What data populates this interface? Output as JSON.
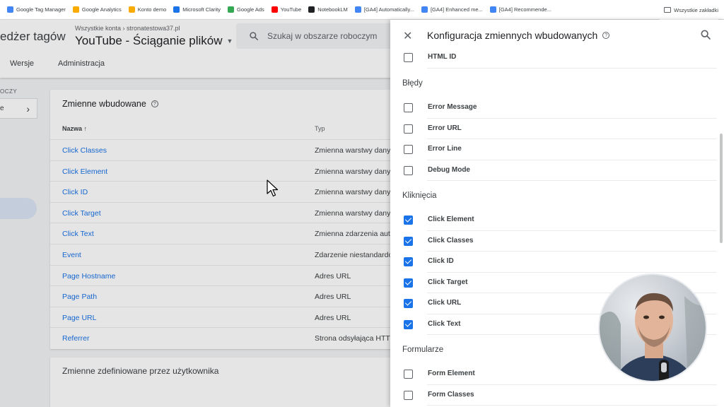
{
  "bookmarks": {
    "items": [
      {
        "label": "Google Tag Manager",
        "color": "#4285f4"
      },
      {
        "label": "Google Analytics",
        "color": "#f9ab00"
      },
      {
        "label": "Konto demo",
        "color": "#f9ab00"
      },
      {
        "label": "Microsoft Clarity",
        "color": "#1a73e8"
      },
      {
        "label": "Google Ads",
        "color": "#34a853"
      },
      {
        "label": "YouTube",
        "color": "#ff0000"
      },
      {
        "label": "NotebookLM",
        "color": "#202124"
      },
      {
        "label": "[GA4] Automatically...",
        "color": "#4285f4"
      },
      {
        "label": "[GA4] Enhanced me...",
        "color": "#4285f4"
      },
      {
        "label": "[GA4] Recommende...",
        "color": "#4285f4"
      }
    ],
    "all_bookmarks": "Wszystkie zakładki"
  },
  "header": {
    "product": "edżer tagów",
    "breadcrumb": "Wszystkie konta › stronatestowa37.pl",
    "container": "YouTube - Ściąganie plików",
    "search_placeholder": "Szukaj w obszarze roboczym",
    "tabs": [
      "Wersje",
      "Administracja"
    ]
  },
  "left": {
    "workspace_label": "OCZY",
    "workspace_value": "e"
  },
  "builtin": {
    "title": "Zmienne wbudowane",
    "col_name": "Nazwa ↑",
    "col_type": "Typ",
    "rows": [
      {
        "name": "Click Classes",
        "type": "Zmienna warstwy danych"
      },
      {
        "name": "Click Element",
        "type": "Zmienna warstwy danych"
      },
      {
        "name": "Click ID",
        "type": "Zmienna warstwy danych"
      },
      {
        "name": "Click Target",
        "type": "Zmienna warstwy danych"
      },
      {
        "name": "Click Text",
        "type": "Zmienna zdarzenia automatycznego"
      },
      {
        "name": "Event",
        "type": "Zdarzenie niestandardowe"
      },
      {
        "name": "Page Hostname",
        "type": "Adres URL"
      },
      {
        "name": "Page Path",
        "type": "Adres URL"
      },
      {
        "name": "Page URL",
        "type": "Adres URL"
      },
      {
        "name": "Referrer",
        "type": "Strona odsyłająca HTTP"
      }
    ]
  },
  "user_defined": {
    "title": "Zmienne zdefiniowane przez użytkownika"
  },
  "panel": {
    "title": "Konfiguracja zmiennych wbudowanych",
    "top_item": {
      "label": "HTML ID",
      "checked": false
    },
    "sections": [
      {
        "title": "Błędy",
        "items": [
          {
            "label": "Error Message",
            "checked": false
          },
          {
            "label": "Error URL",
            "checked": false
          },
          {
            "label": "Error Line",
            "checked": false
          },
          {
            "label": "Debug Mode",
            "checked": false
          }
        ]
      },
      {
        "title": "Kliknięcia",
        "items": [
          {
            "label": "Click Element",
            "checked": true
          },
          {
            "label": "Click Classes",
            "checked": true
          },
          {
            "label": "Click ID",
            "checked": true
          },
          {
            "label": "Click Target",
            "checked": true
          },
          {
            "label": "Click URL",
            "checked": true
          },
          {
            "label": "Click Text",
            "checked": true
          }
        ]
      },
      {
        "title": "Formularze",
        "items": [
          {
            "label": "Form Element",
            "checked": false
          },
          {
            "label": "Form Classes",
            "checked": false
          }
        ]
      }
    ]
  },
  "colors": {
    "accent": "#1a73e8",
    "link": "#1a73e8"
  }
}
